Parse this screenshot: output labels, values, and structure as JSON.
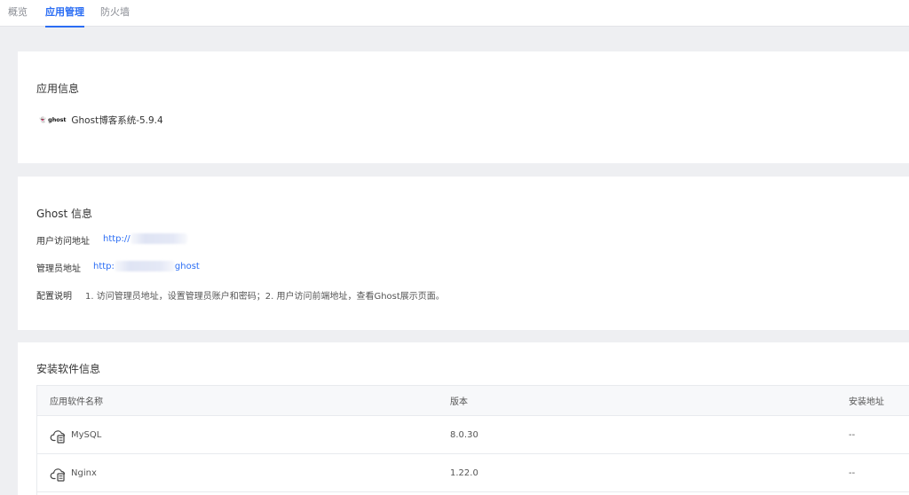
{
  "tabs": [
    {
      "label": "概览",
      "active": false
    },
    {
      "label": "应用管理",
      "active": true
    },
    {
      "label": "防火墙",
      "active": false
    }
  ],
  "app_info": {
    "title": "应用信息",
    "logo_text": "👻 ghost",
    "app_name": "Ghost博客系统-5.9.4"
  },
  "ghost_info": {
    "title": "Ghost 信息",
    "user_url_label": "用户访问地址",
    "user_url_prefix": "http://",
    "admin_url_label": "管理员地址",
    "admin_url_prefix": "http:",
    "admin_url_suffix": "ghost",
    "config_label": "配置说明",
    "config_text": "1. 访问管理员地址，设置管理员账户和密码；2. 用户访问前端地址，查看Ghost展示页面。"
  },
  "software_info": {
    "title": "安装软件信息",
    "columns": [
      "应用软件名称",
      "版本",
      "安装地址"
    ],
    "rows": [
      {
        "icon": "cloud-server-icon",
        "name": "MySQL",
        "version": "8.0.30",
        "path": "--"
      },
      {
        "icon": "cloud-server-icon",
        "name": "Nginx",
        "version": "1.22.0",
        "path": "--"
      }
    ]
  },
  "colors": {
    "accent": "#2a6df4",
    "page_background": "#eeeff2",
    "card_background": "#ffffff"
  }
}
